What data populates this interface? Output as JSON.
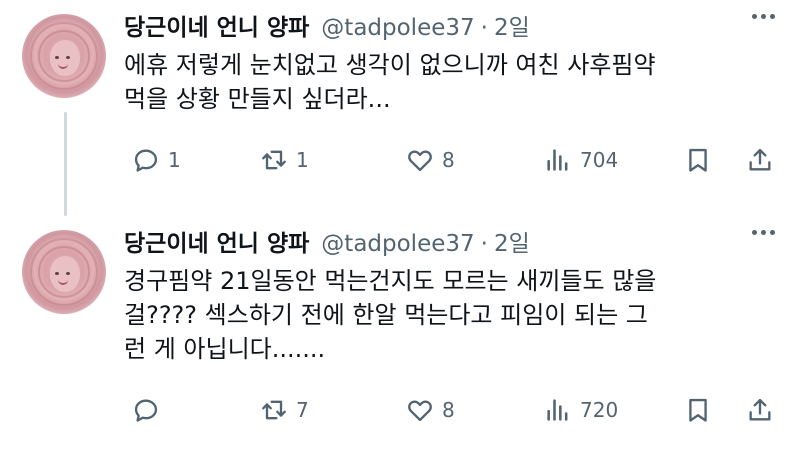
{
  "tweets": [
    {
      "display_name": "당근이네 언니 양파",
      "handle": "@tadpolee37",
      "separator": "·",
      "time": "2일",
      "lines": [
        "에휴 저렇게 눈치없고 생각이 없으니까 여친 사후핌약",
        "먹을 상황 만들지 싶더라..."
      ],
      "replies": "1",
      "retweets": "1",
      "likes": "8",
      "views": "704"
    },
    {
      "display_name": "당근이네 언니 양파",
      "handle": "@tadpolee37",
      "separator": "·",
      "time": "2일",
      "lines": [
        "경구핌약 21일동안 먹는건지도 모르는 새끼들도 많을",
        "걸???? 섹스하기 전에 한알 먹는다고 피임이 되는 그",
        "런 게 아닙니다......."
      ],
      "replies": "",
      "retweets": "7",
      "likes": "8",
      "views": "720"
    }
  ],
  "icons": {
    "reply": "reply-icon",
    "retweet": "retweet-icon",
    "like": "heart-icon",
    "views": "views-icon",
    "bookmark": "bookmark-icon",
    "share": "share-icon",
    "more": "more-icon"
  },
  "colors": {
    "text": "#0f1419",
    "secondary": "#536471",
    "thread_line": "#cfd9de"
  }
}
